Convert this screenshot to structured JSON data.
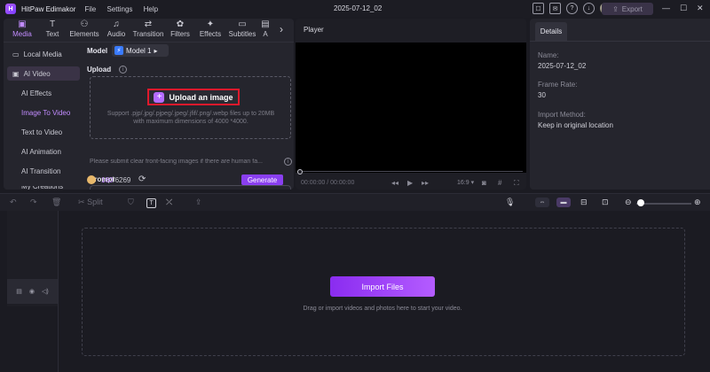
{
  "app": {
    "name": "HitPaw Edimakor",
    "menu": [
      "File",
      "Settings",
      "Help"
    ],
    "project_title": "2025-07-12_02",
    "export_label": "Export"
  },
  "tabs": [
    {
      "label": "Media",
      "icon": "media-icon",
      "active": true
    },
    {
      "label": "Text",
      "icon": "text-icon"
    },
    {
      "label": "Elements",
      "icon": "elements-icon"
    },
    {
      "label": "Audio",
      "icon": "audio-icon"
    },
    {
      "label": "Transition",
      "icon": "transition-icon"
    },
    {
      "label": "Filters",
      "icon": "filters-icon"
    },
    {
      "label": "Effects",
      "icon": "effects-icon"
    },
    {
      "label": "Subtitles",
      "icon": "subtitles-icon"
    },
    {
      "label": "A",
      "icon": "more-tab-icon"
    }
  ],
  "sidebar": {
    "local_media": "Local Media",
    "ai_video": "AI Video",
    "items": [
      "AI Effects",
      "Image To Video",
      "Text to Video",
      "AI Animation",
      "AI Transition",
      "My Creations"
    ]
  },
  "content": {
    "model_label": "Model",
    "model_value": "Model 1",
    "upload_label": "Upload",
    "upload_button": "Upload an image",
    "support_line1": "Support .pjp/.jpg/.pjpeg/.jpeg/.jfif/.png/.webp files up to 20MB",
    "support_line2": "with maximum dimensions of 4000 *4000.",
    "submit_note": "Please submit clear front-facing images if there are human fa...",
    "prompt_label": "Prompt"
  },
  "generate": {
    "credits_used": "160",
    "credits_total": "/6269",
    "button": "Generate"
  },
  "player": {
    "title": "Player",
    "timecode": "00:00:00 / 00:00:00",
    "aspect": "16:9"
  },
  "details": {
    "tab": "Details",
    "name_label": "Name:",
    "name_value": "2025-07-12_02",
    "frame_rate_label": "Frame Rate:",
    "frame_rate_value": "30",
    "import_method_label": "Import Method:",
    "import_method_value": "Keep in original location"
  },
  "timeline": {
    "split_label": "Split",
    "import_button": "Import Files",
    "drop_hint": "Drag or import videos and photos here to start your video."
  },
  "colors": {
    "accent": "#8a3ff0",
    "active_text": "#c28cff",
    "highlight_border": "#e0192c"
  }
}
